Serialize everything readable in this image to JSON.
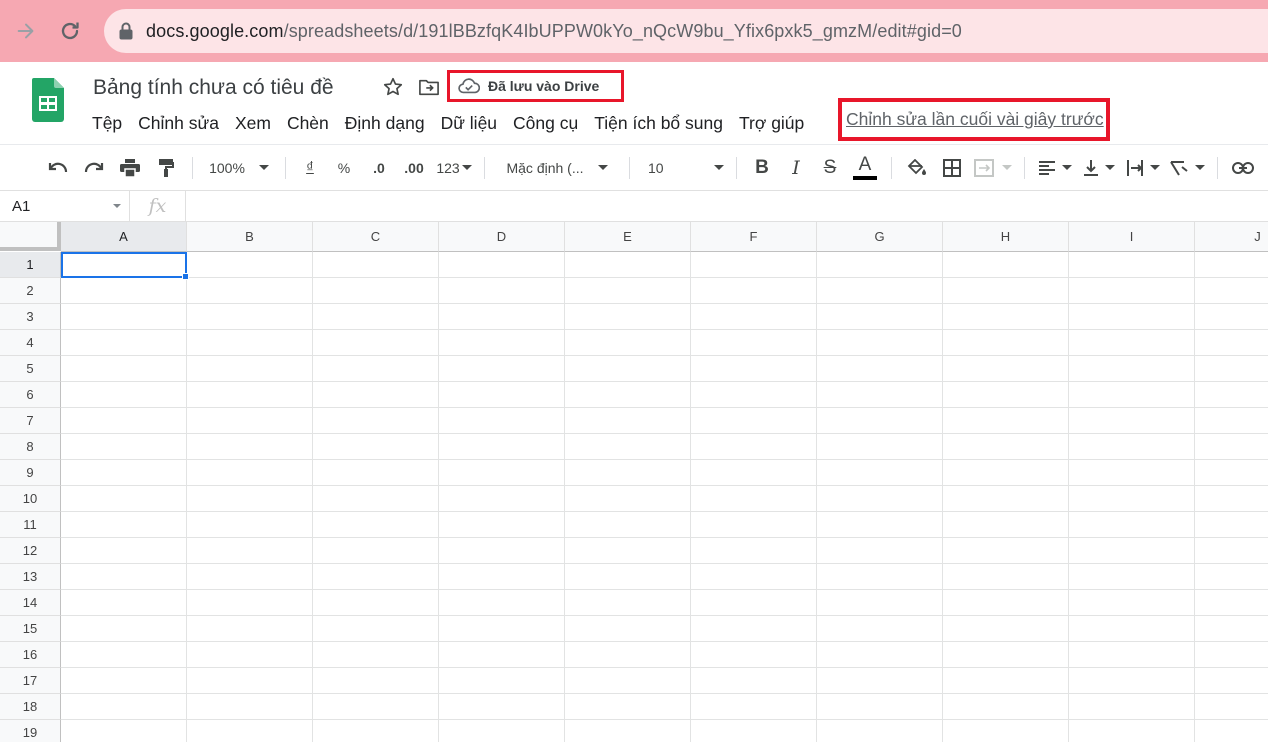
{
  "browser": {
    "url_host": "docs.google.com",
    "url_path": "/spreadsheets/d/191lBBzfqK4IbUPPW0kYo_nQcW9bu_Yfix6pxk5_gmzM/edit#gid=0"
  },
  "app": {
    "title": "Bảng tính chưa có tiêu đề",
    "saved_status": "Đã lưu vào Drive",
    "last_edit": "Chỉnh sửa lần cuối vài giây trước",
    "menu": [
      "Tệp",
      "Chỉnh sửa",
      "Xem",
      "Chèn",
      "Định dạng",
      "Dữ liệu",
      "Công cụ",
      "Tiện ích bổ sung",
      "Trợ giúp"
    ]
  },
  "toolbar": {
    "zoom": "100%",
    "currency": "₫",
    "percent": "%",
    "dec_decrease": ".0",
    "dec_increase": ".00",
    "more_formats": "123",
    "font": "Mặc định (...",
    "font_size": "10",
    "bold": "B",
    "italic": "I",
    "strike": "S",
    "text_color": "A"
  },
  "formula_bar": {
    "cell_ref": "A1",
    "fx": "fx"
  },
  "sheet": {
    "columns": [
      "A",
      "B",
      "C",
      "D",
      "E",
      "F",
      "G",
      "H",
      "I",
      "J"
    ],
    "rows": [
      "1",
      "2",
      "3",
      "4",
      "5",
      "6",
      "7",
      "8",
      "9",
      "10",
      "11",
      "12",
      "13",
      "14",
      "15",
      "16",
      "17",
      "18",
      "19"
    ],
    "selected_cell": "A1"
  },
  "colors": {
    "browser_bar": "#f6a8b2",
    "highlight_box": "#e8162a",
    "selection": "#1a73e8",
    "sheets_green": "#23a566"
  }
}
